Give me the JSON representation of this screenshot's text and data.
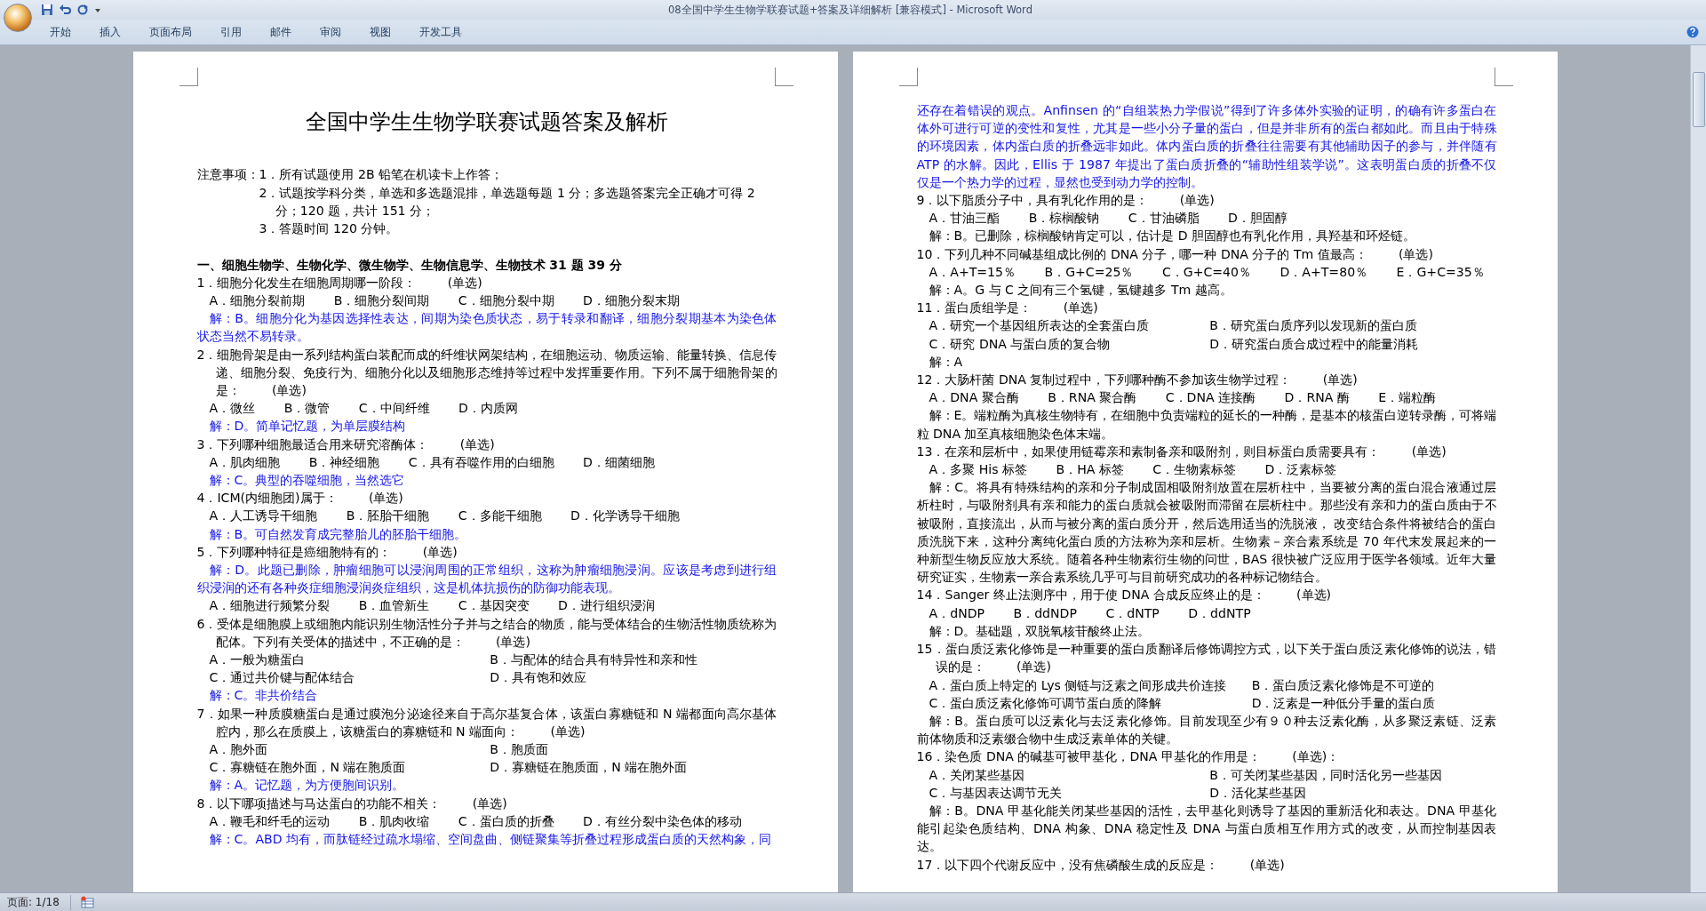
{
  "window": {
    "title": "08全国中学生生物学联赛试题+答案及详细解析 [兼容模式] - Microsoft Word"
  },
  "ribbon_tabs": [
    {
      "label": "开始",
      "selected": false
    },
    {
      "label": "插入",
      "selected": false
    },
    {
      "label": "页面布局",
      "selected": false
    },
    {
      "label": "引用",
      "selected": false
    },
    {
      "label": "邮件",
      "selected": false
    },
    {
      "label": "审阅",
      "selected": false
    },
    {
      "label": "视图",
      "selected": false
    },
    {
      "label": "开发工具",
      "selected": false
    }
  ],
  "pages": [
    {
      "blocks": [
        {
          "kind": "title",
          "text": "全国中学生生物学联赛试题答案及解析"
        },
        {
          "kind": "blank"
        },
        {
          "kind": "notes",
          "label": "注意事项：",
          "items": [
            "1．所有试题使用 2B 铅笔在机读卡上作答；",
            "2．试题按学科分类，单选和多选题混排，单选题每题 1 分；多选题答案完全正确才可得 2 分；120 题，共计 151 分；",
            "3．答题时间 120 分钟。"
          ]
        },
        {
          "kind": "blank"
        },
        {
          "kind": "heading",
          "text": "一、细胞生物学、生物化学、微生物学、生物信息学、生物技术 31 题 39 分"
        },
        {
          "kind": "question",
          "text": "1．细胞分化发生在细胞周期哪一阶段：",
          "tag": "(单选)"
        },
        {
          "kind": "options_inline",
          "items": [
            "A．细胞分裂前期",
            "B．细胞分裂间期",
            "C．细胞分裂中期",
            "D．细胞分裂末期"
          ]
        },
        {
          "kind": "answer",
          "text": "解：B。细胞分化为基因选择性表达，间期为染色质状态，易于转录和翻译，细胞分裂期基本为染色体状态当然不易转录。"
        },
        {
          "kind": "question",
          "text": "2．细胞骨架是由一系列结构蛋白装配而成的纤维状网架结构，在细胞运动、物质运输、能量转换、信息传递、细胞分裂、免疫行为、细胞分化以及细胞形态维持等过程中发挥重要作用。下列不属于细胞骨架的是：",
          "tag": "(单选)"
        },
        {
          "kind": "options_inline",
          "items": [
            "A．微丝",
            "B．微管",
            "C．中间纤维",
            "D．内质网"
          ]
        },
        {
          "kind": "answer",
          "text": "解：D。简单记忆题，为单层膜结构"
        },
        {
          "kind": "question",
          "text": "3．下列哪种细胞最适合用来研究溶酶体：",
          "tag": "(单选)"
        },
        {
          "kind": "options_inline",
          "items": [
            "A．肌肉细胞",
            "B．神经细胞",
            "C．具有吞噬作用的白细胞",
            "D．细菌细胞"
          ]
        },
        {
          "kind": "answer",
          "text": "解：C。典型的吞噬细胞，当然选它"
        },
        {
          "kind": "question",
          "text": "4．ICM(内细胞团)属于：",
          "tag": "(单选)"
        },
        {
          "kind": "options_inline",
          "items": [
            "A．人工诱导干细胞",
            "B．胚胎干细胞",
            "C．多能干细胞",
            "D．化学诱导干细胞"
          ]
        },
        {
          "kind": "answer",
          "text": "解：B。可自然发育成完整胎儿的胚胎干细胞。"
        },
        {
          "kind": "question",
          "text": "5．下列哪种特征是癌细胞特有的：",
          "tag": "(单选)"
        },
        {
          "kind": "answer",
          "text": "解：D。此题已删除，肿瘤细胞可以浸润周围的正常组织，这称为肿瘤细胞浸润。应该是考虑到进行组织浸润的还有各种炎症细胞浸润炎症组织，这是机体抗损伤的防御功能表现。"
        },
        {
          "kind": "options_inline",
          "items": [
            "A．细胞进行频繁分裂",
            "B．血管新生",
            "C．基因突变",
            "D．进行组织浸润"
          ]
        },
        {
          "kind": "question",
          "text": "6．受体是细胞膜上或细胞内能识别生物活性分子并与之结合的物质，能与受体结合的生物活性物质统称为配体。下列有关受体的描述中，不正确的是：",
          "tag": "(单选)"
        },
        {
          "kind": "options_grid",
          "items": [
            "A．一般为糖蛋白",
            "B．与配体的结合具有特异性和亲和性",
            "C．通过共价键与配体结合",
            "D．具有饱和效应"
          ]
        },
        {
          "kind": "answer",
          "text": "解：C。非共价结合"
        },
        {
          "kind": "question",
          "text": "7．如果一种质膜糖蛋白是通过膜泡分泌途径来自于高尔基复合体，该蛋白寡糖链和 N 端都面向高尔基体腔内，那么在质膜上，该糖蛋白的寡糖链和 N 端面向：",
          "tag": "(单选)"
        },
        {
          "kind": "options_grid",
          "items": [
            "A．胞外面",
            "B．胞质面",
            "C．寡糖链在胞外面，N 端在胞质面",
            "D．寡糖链在胞质面，N 端在胞外面"
          ]
        },
        {
          "kind": "answer",
          "text": "解：A。记忆题，为方便胞间识别。"
        },
        {
          "kind": "question",
          "text": "8．以下哪项描述与马达蛋白的功能不相关：",
          "tag": "(单选)"
        },
        {
          "kind": "options_inline",
          "items": [
            "A．鞭毛和纤毛的运动",
            "B．肌肉收缩",
            "C．蛋白质的折叠",
            "D．有丝分裂中染色体的移动"
          ]
        },
        {
          "kind": "answer",
          "text": "解：C。ABD 均有，而肽链经过疏水塌缩、空间盘曲、侧链聚集等折叠过程形成蛋白质的天然构象，同"
        }
      ]
    },
    {
      "blocks": [
        {
          "kind": "answer_continued",
          "text": "还存在着错误的观点。Anfinsen 的“自组装热力学假说”得到了许多体外实验的证明，的确有许多蛋白在体外可进行可逆的变性和复性，尤其是一些小分子量的蛋白，但是并非所有的蛋白都如此。而且由于特殊的环境因素，体内蛋白质的折叠远非如此。体内蛋白质的折叠往往需要有其他辅助因子的参与，并伴随有 ATP 的水解。因此，Ellis 于 1987 年提出了蛋白质折叠的“辅助性组装学说”。这表明蛋白质的折叠不仅仅是一个热力学的过程，显然也受到动力学的控制。"
        },
        {
          "kind": "question",
          "text": "9．以下脂质分子中，具有乳化作用的是：",
          "tag": "(单选)"
        },
        {
          "kind": "options_inline",
          "items": [
            "A．甘油三酯",
            "B．棕榈酸钠",
            "C．甘油磷脂",
            "D．胆固醇"
          ]
        },
        {
          "kind": "note",
          "text": "解：B。已删除，棕榈酸钠肯定可以，估计是 D 胆固醇也有乳化作用，具羟基和环烃链。"
        },
        {
          "kind": "question",
          "text": "10．下列几种不同碱基组成比例的 DNA 分子，哪一种 DNA 分子的 Tm 值最高：",
          "tag": "(单选)"
        },
        {
          "kind": "options_inline",
          "items": [
            "A．A+T=15％",
            "B．G+C=25％",
            "C．G+C=40％",
            "D．A+T=80％",
            "E．G+C=35％"
          ]
        },
        {
          "kind": "note",
          "text": "解：A。G 与 C 之间有三个氢键，氢键越多 Tm 越高。"
        },
        {
          "kind": "question",
          "text": "11．蛋白质组学是：",
          "tag": "(单选)"
        },
        {
          "kind": "options_grid",
          "items": [
            "A．研究一个基因组所表达的全套蛋白质",
            "B．研究蛋白质序列以发现新的蛋白质",
            "C．研究 DNA 与蛋白质的复合物",
            "D．研究蛋白质合成过程中的能量消耗"
          ]
        },
        {
          "kind": "note",
          "text": "解：A"
        },
        {
          "kind": "question",
          "text": "12．大肠杆菌 DNA 复制过程中，下列哪种酶不参加该生物学过程：",
          "tag": "(单选)"
        },
        {
          "kind": "options_inline",
          "items": [
            "A．DNA 聚合酶",
            "B．RNA 聚合酶",
            "C．DNA 连接酶",
            "D．RNA 酶",
            "E．端粒酶"
          ]
        },
        {
          "kind": "note",
          "text": "解：E。端粒酶为真核生物特有，在细胞中负责端粒的延长的一种酶，是基本的核蛋白逆转录酶，可将端粒 DNA 加至真核细胞染色体末端。"
        },
        {
          "kind": "question",
          "text": "13．在亲和层析中，如果使用链霉亲和素制备亲和吸附剂，则目标蛋白质需要具有：",
          "tag": "(单选)"
        },
        {
          "kind": "options_inline",
          "items": [
            "A．多聚 His 标签",
            "B．HA 标签",
            "C．生物素标签",
            "D．泛素标签"
          ]
        },
        {
          "kind": "note",
          "text": "解：C。将具有特殊结构的亲和分子制成固相吸附剂放置在层析柱中，当要被分离的蛋白混合液通过层析柱时，与吸附剂具有亲和能力的蛋白质就会被吸附而滞留在层析柱中。那些没有亲和力的蛋白质由于不被吸附，直接流出，从而与被分离的蛋白质分开，然后选用适当的洗脱液， 改变结合条件将被结合的蛋白质洗脱下来，这种分离纯化蛋白质的方法称为亲和层析。生物素－亲合素系统是 70 年代末发展起来的一种新型生物反应放大系统。随着各种生物素衍生物的问世，BAS 很快被广泛应用于医学各领域。近年大量研究证实，生物素一亲合素系统几乎可与目前研究成功的各种标记物结合。"
        },
        {
          "kind": "question",
          "text": "14．Sanger 终止法测序中，用于使 DNA 合成反应终止的是：",
          "tag": "(单选)"
        },
        {
          "kind": "options_inline",
          "items": [
            "A．dNDP",
            "B．ddNDP",
            "C．dNTP",
            "D．ddNTP"
          ]
        },
        {
          "kind": "note",
          "text": "解：D。基础题，双脱氧核苷酸终止法。"
        },
        {
          "kind": "question",
          "text": "15．蛋白质泛素化修饰是一种重要的蛋白质翻译后修饰调控方式，以下关于蛋白质泛素化修饰的说法，错误的是：",
          "tag": "(单选)"
        },
        {
          "kind": "options_grid",
          "items": [
            "A．蛋白质上特定的 Lys 侧链与泛素之间形成共价连接",
            "B．蛋白质泛素化修饰是不可逆的",
            "C．蛋白质泛素化修饰可调节蛋白质的降解",
            "D．泛素是一种低分手量的蛋白质"
          ]
        },
        {
          "kind": "note",
          "text": "解：B。蛋白质可以泛素化与去泛素化修饰。目前发现至少有９０种去泛素化酶，从多聚泛素链、泛素前体物质和泛素缀合物中生成泛素单体的关键。"
        },
        {
          "kind": "question",
          "text": "16．染色质 DNA 的碱基可被甲基化，DNA 甲基化的作用是：",
          "tag": "(单选)："
        },
        {
          "kind": "options_grid",
          "items": [
            "A．关闭某些基因",
            "B．可关闭某些基因，同时活化另一些基因",
            "C．与基因表达调节无关",
            "D．活化某些基因"
          ]
        },
        {
          "kind": "note",
          "text": "解：B。DNA 甲基化能关闭某些基因的活性，去甲基化则诱导了基因的重新活化和表达。DNA 甲基化能引起染色质结构、DNA 构象、DNA 稳定性及 DNA 与蛋白质相互作用方式的改变，从而控制基因表达。"
        },
        {
          "kind": "question",
          "text": "17．以下四个代谢反应中，没有焦磷酸生成的反应是：",
          "tag": "(单选)"
        }
      ]
    }
  ],
  "status_bar": {
    "page": "页面: 1/18"
  }
}
